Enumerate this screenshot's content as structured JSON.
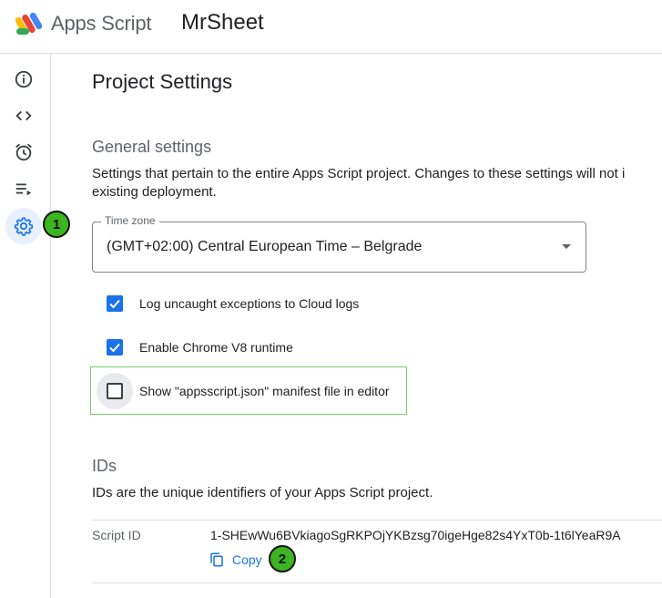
{
  "header": {
    "brand": "Apps Script",
    "project_name": "MrSheet"
  },
  "rail": {
    "items": [
      {
        "name": "overview",
        "icon": "info-icon"
      },
      {
        "name": "editor",
        "icon": "code-icon"
      },
      {
        "name": "triggers",
        "icon": "alarm-icon"
      },
      {
        "name": "executions",
        "icon": "executions-icon"
      },
      {
        "name": "settings",
        "icon": "gear-icon",
        "active": true
      }
    ]
  },
  "markers": {
    "one": "1",
    "two": "2"
  },
  "page": {
    "title": "Project Settings"
  },
  "general": {
    "heading": "General settings",
    "description_line1": "Settings that pertain to the entire Apps Script project. Changes to these settings will not i",
    "description_line2": "existing deployment.",
    "timezone_label": "Time zone",
    "timezone_value": "(GMT+02:00) Central European Time – Belgrade",
    "checkboxes": [
      {
        "label": "Log uncaught exceptions to Cloud logs",
        "checked": true
      },
      {
        "label": "Enable Chrome V8 runtime",
        "checked": true
      },
      {
        "label": "Show \"appsscript.json\" manifest file in editor",
        "checked": false
      }
    ]
  },
  "ids": {
    "heading": "IDs",
    "description": "IDs are the unique identifiers of your Apps Script project.",
    "script_id_label": "Script ID",
    "script_id_value": "1-SHEwWu6BVkiagoSgRKPOjYKBzsg70igeHge82s4YxT0b-1t6lYeaR9A",
    "copy_label": "Copy"
  },
  "colors": {
    "accent": "#1a73e8",
    "marker": "#3cb521",
    "highlight_border": "#7ccc6a"
  }
}
